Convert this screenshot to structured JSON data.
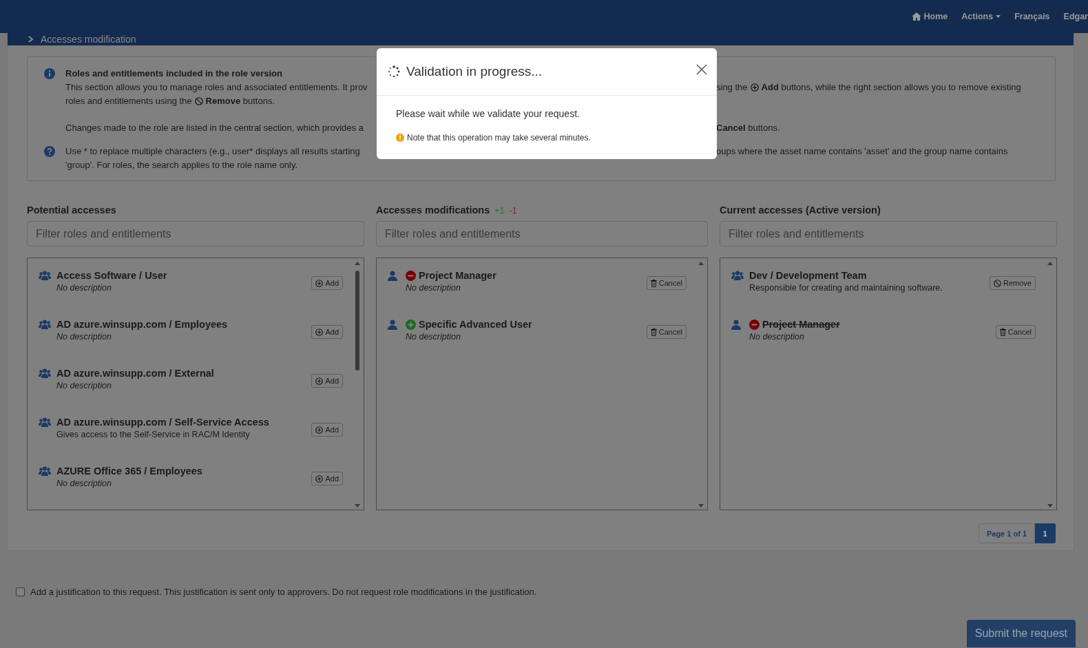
{
  "navbar": {
    "items": [
      {
        "label": "Home",
        "kind": "home"
      },
      {
        "label": "Actions",
        "kind": "menu"
      },
      {
        "label": "Français",
        "kind": "link"
      },
      {
        "label": "Edgar",
        "kind": "link"
      }
    ]
  },
  "card": {
    "title": "Accesses modification"
  },
  "info": {
    "title": "Roles and entitlements included in the role version",
    "blocks": [
      {
        "kind": "info",
        "paragraphs": [
          [
            {
              "segments": [
                [
                  {
                    "kind": "text",
                    "text": "This section allows you to manage roles and associated entitlements. It prov"
                  }
                ],
                [
                  {
                    "kind": "text",
                    "text": "sing the"
                  },
                  {
                    "kind": "add"
                  },
                  {
                    "kind": "text",
                    "text": "**Add** buttons, while the right section allows you to remove existing"
                  }
                ]
              ]
            },
            {
              "segments": [
                [
                  {
                    "kind": "text",
                    "text": "roles and entitlements using the"
                  },
                  {
                    "kind": "remove"
                  },
                  {
                    "kind": "text",
                    "text": "**Remove** buttons."
                  }
                ]
              ]
            }
          ],
          [
            {
              "segments": [
                [
                  {
                    "kind": "text",
                    "text": "Changes made to the role are listed in the central section, which provides a"
                  }
                ],
                [
                  {
                    "kind": "text",
                    "text": "**Cancel** buttons."
                  }
                ]
              ]
            }
          ]
        ]
      },
      {
        "kind": "help",
        "paragraphs": [
          [
            {
              "segments": [
                [
                  {
                    "kind": "text",
                    "text": "Use * to replace multiple characters (e.g., user* displays all results starting"
                  }
                ],
                [
                  {
                    "kind": "text",
                    "text": "oups where the asset name contains 'asset' and the group name contains"
                  }
                ]
              ]
            },
            {
              "segments": [
                [
                  {
                    "kind": "text",
                    "text": "'group'. For roles, the search applies to the role name only."
                  }
                ]
              ]
            }
          ]
        ]
      }
    ]
  },
  "columns": [
    {
      "title": "Potential accesses",
      "placeholder": "Filter roles and entitlements",
      "items": [
        {
          "kind": "group",
          "name": "Access Software / User",
          "description": "No description",
          "italic": true,
          "struck": false,
          "action": {
            "kind": "add",
            "label": "Add"
          }
        },
        {
          "kind": "group",
          "name": "AD azure.winsupp.com / Employees",
          "description": "No description",
          "italic": true,
          "struck": false,
          "action": {
            "kind": "add",
            "label": "Add"
          }
        },
        {
          "kind": "group",
          "name": "AD azure.winsupp.com / External",
          "description": "No description",
          "italic": true,
          "struck": false,
          "action": {
            "kind": "add",
            "label": "Add"
          }
        },
        {
          "kind": "group",
          "name": "AD azure.winsupp.com / Self-Service Access",
          "description": "Gives access to the Self-Service in RAC/M Identity",
          "italic": false,
          "struck": false,
          "action": {
            "kind": "add",
            "label": "Add"
          }
        },
        {
          "kind": "group",
          "name": "AZURE Office 365 / Employees",
          "description": "No description",
          "italic": true,
          "struck": false,
          "action": {
            "kind": "add",
            "label": "Add"
          }
        }
      ]
    },
    {
      "title": "Accesses modifications",
      "badges": [
        {
          "text": "+1",
          "color": "#2a6e2a"
        },
        {
          "text": "-1",
          "color": "#961c1c"
        }
      ],
      "placeholder": "Filter roles and entitlements",
      "items": [
        {
          "kind": "user",
          "removed": true,
          "name": "Project Manager",
          "description": "No description",
          "italic": true,
          "struck": false,
          "action": {
            "kind": "cancel",
            "label": "Cancel"
          }
        },
        {
          "kind": "user",
          "added": true,
          "name": "Specific Advanced User",
          "description": "No description",
          "italic": true,
          "struck": false,
          "action": {
            "kind": "cancel",
            "label": "Cancel"
          }
        }
      ]
    },
    {
      "title": "Current accesses (Active version)",
      "placeholder": "Filter roles and entitlements",
      "items": [
        {
          "kind": "group",
          "name": "Dev / Development Team",
          "description": "Responsible for creating and maintaining software.",
          "italic": false,
          "struck": false,
          "action": {
            "kind": "remove",
            "label": "Remove"
          }
        },
        {
          "kind": "user",
          "removed": true,
          "name": "Project Manager",
          "description": "No description",
          "italic": true,
          "struck": true,
          "action": {
            "kind": "cancel",
            "label": "Cancel"
          }
        }
      ]
    }
  ],
  "pagination": {
    "label": "Page 1 of 1",
    "pages": [
      {
        "label": "1",
        "selected": true
      }
    ]
  },
  "justification": {
    "checked": false,
    "label": "Add a justification to this request. This justification is sent only to approvers. Do not request role modifications in the justification."
  },
  "submit": {
    "label": "Submit the request"
  },
  "modal": {
    "title": "Validation in progress...",
    "message": "Please wait while we validate your request.",
    "note": "Note that this operation may take several minutes."
  }
}
